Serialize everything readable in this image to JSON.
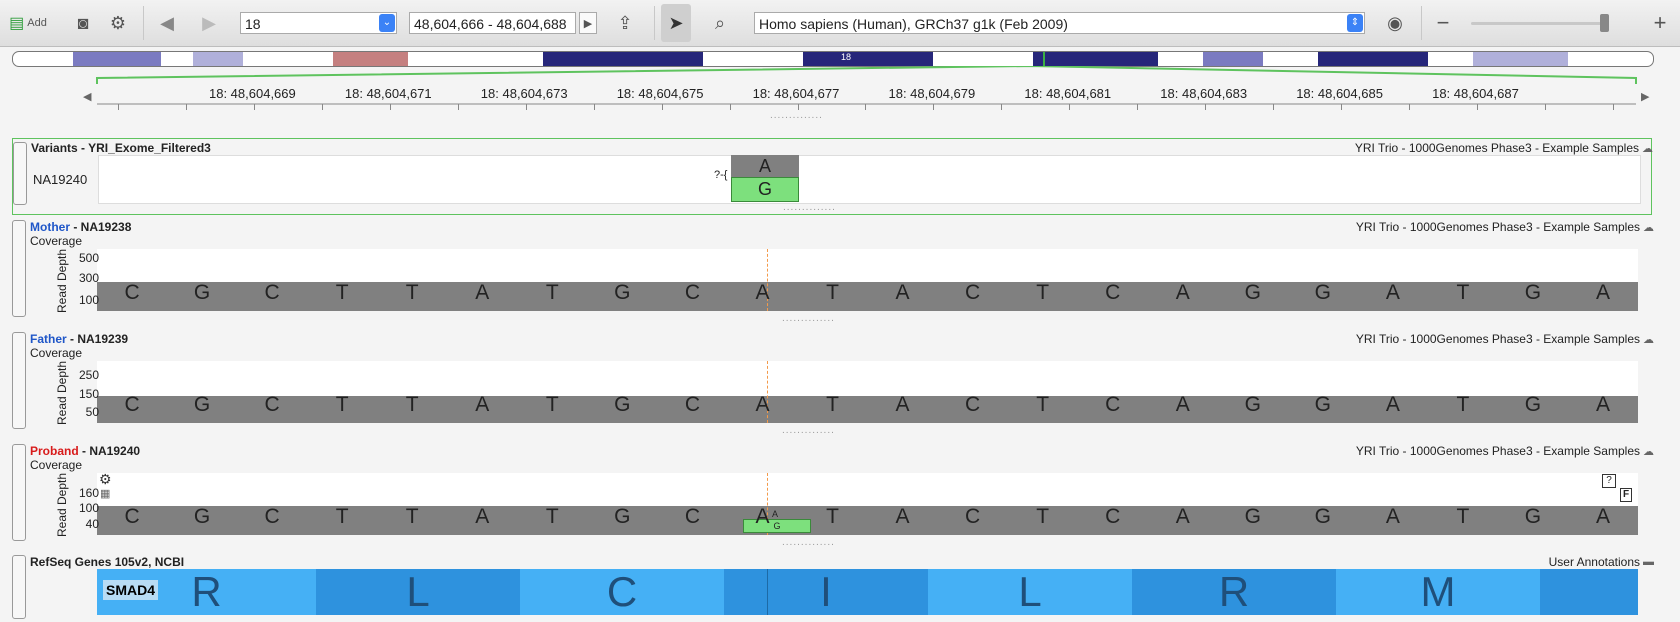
{
  "toolbar": {
    "add_label": "Add",
    "chromosome_value": "18",
    "range_value": "48,604,666 - 48,604,688",
    "genome_value": "Homo sapiens (Human), GRCh37 g1k (Feb 2009)",
    "zoom_level": 0.9
  },
  "ideogram": {
    "label": "18"
  },
  "ruler": {
    "ticks": [
      "18: 48,604,669",
      "18: 48,604,671",
      "18: 48,604,673",
      "18: 48,604,675",
      "18: 48,604,677",
      "18: 48,604,679",
      "18: 48,604,681",
      "18: 48,604,683",
      "18: 48,604,685",
      "18: 48,604,687"
    ]
  },
  "variants": {
    "title": "Variants - YRI_Exome_Filtered3",
    "source": "YRI Trio - 1000Genomes Phase3 - Example Samples",
    "sample": "NA19240",
    "ref_allele": "A",
    "alt_allele": "G",
    "marker": "?-{"
  },
  "mother": {
    "role": "Mother",
    "sample": " - NA19238",
    "source": "YRI Trio - 1000Genomes Phase3 - Example Samples",
    "coverage": "Coverage",
    "ylabel": "Read Depth",
    "yticks": [
      "500",
      "300",
      "100"
    ]
  },
  "father": {
    "role": "Father",
    "sample": " - NA19239",
    "source": "YRI Trio - 1000Genomes Phase3 - Example Samples",
    "coverage": "Coverage",
    "ylabel": "Read Depth",
    "yticks": [
      "250",
      "150",
      "50"
    ]
  },
  "proband": {
    "role": "Proband",
    "sample": " - NA19240",
    "source": "YRI Trio - 1000Genomes Phase3 - Example Samples",
    "coverage": "Coverage",
    "ylabel": "Read Depth",
    "yticks": [
      "160",
      "100",
      "40"
    ],
    "ref_allele": "A",
    "alt_allele": "G",
    "help": "?",
    "f_label": "F"
  },
  "bases": [
    "C",
    "G",
    "C",
    "T",
    "T",
    "A",
    "T",
    "G",
    "C",
    "A",
    "T",
    "A",
    "C",
    "T",
    "C",
    "A",
    "G",
    "G",
    "A",
    "T",
    "G",
    "A"
  ],
  "refseq": {
    "title": "RefSeq Genes 105v2, NCBI",
    "source": "User Annotations",
    "gene": "SMAD4",
    "amino_acids": [
      "R",
      "L",
      "C",
      "I",
      "L",
      "R",
      "M"
    ]
  },
  "colors": {
    "accent": "#3b82f6",
    "coverage": "#808080",
    "variant_alt": "#7de07d",
    "variant_ref": "#808080",
    "mother": "#1f56c8",
    "father": "#1f56c8",
    "proband": "#d81b1b",
    "gene_dark": "#2e92de",
    "gene_light": "#45b0f5"
  }
}
